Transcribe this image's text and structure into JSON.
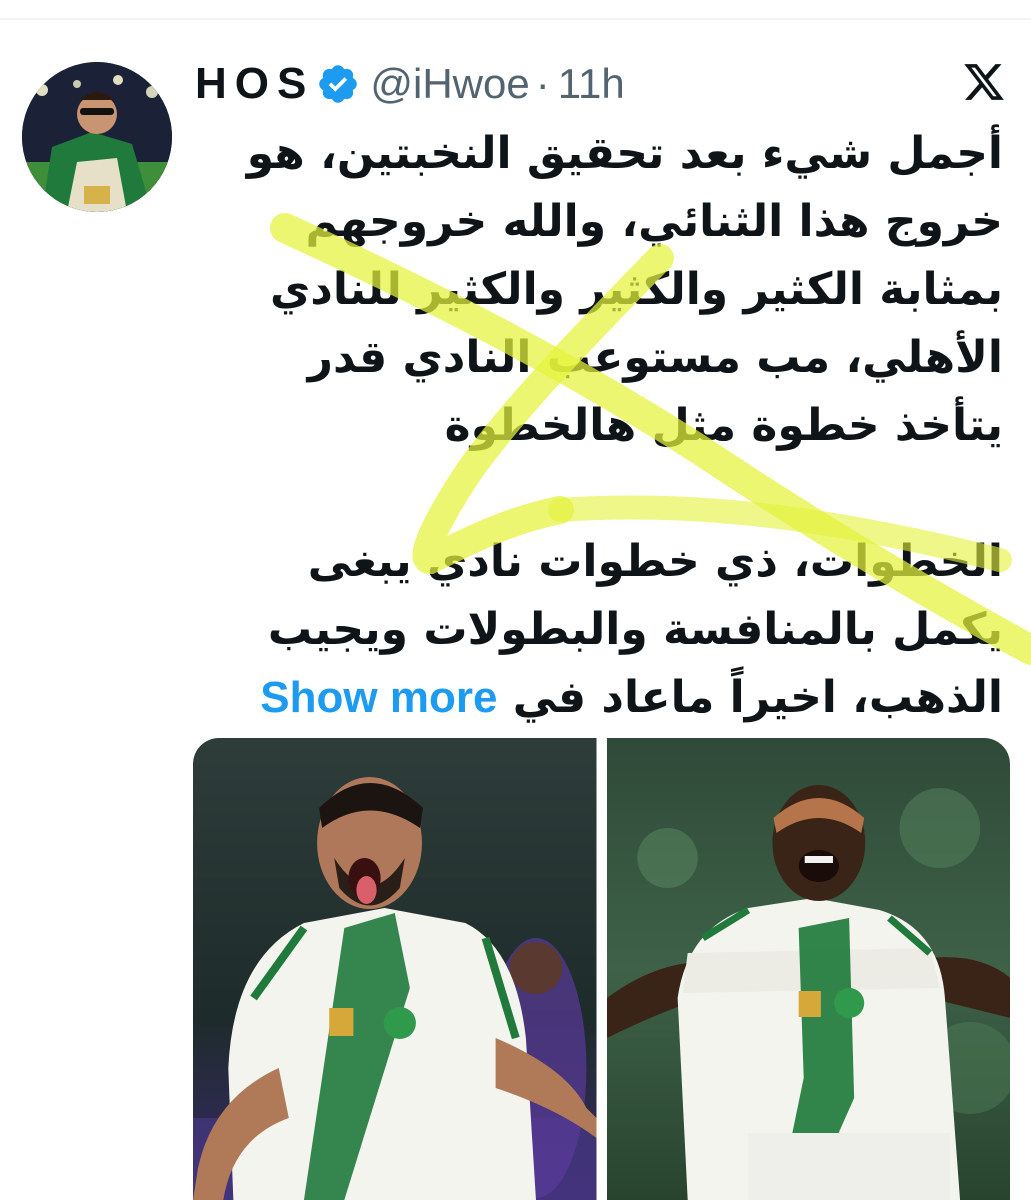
{
  "tweet": {
    "display_name": "HOS",
    "handle": "@iHwoe",
    "separator": "·",
    "timestamp": "11h",
    "text_lines": [
      "أجمل شيء بعد تحقيق النخبتين، هو",
      "خروج هذا الثنائي، والله خروجهم",
      "بمثابة الكثير والكثير والكثير للنادي",
      "الأهلي، مب مستوعب النادي قدر",
      "يتأخذ خطوة مثل هالخطوة",
      "الخطوات، ذي خطوات نادي يبغى",
      "يكمل بالمنافسة والبطولات ويجيب",
      "الذهب، اخيراً ماعاد في"
    ],
    "show_more_label": "Show more"
  },
  "icons": {
    "verified": "verified-badge-icon",
    "platform": "x-logo-icon"
  },
  "colors": {
    "text": "#0f1419",
    "secondary": "#536471",
    "link": "#1d9bf0",
    "verified": "#1d9bf0",
    "highlighter": "#e5f23a",
    "kit_green": "#1f7a3c"
  },
  "media": {
    "count": 2
  }
}
